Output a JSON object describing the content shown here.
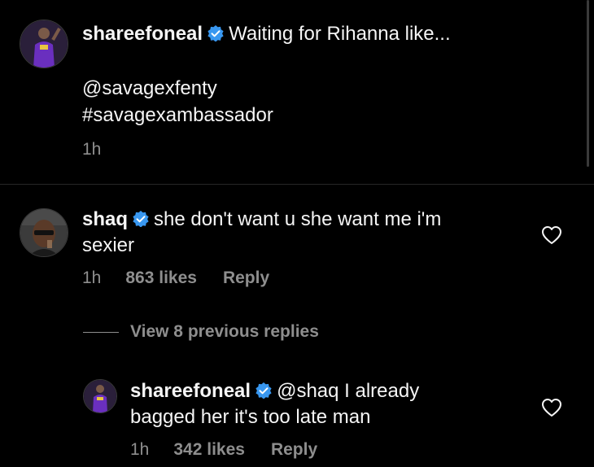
{
  "caption": {
    "username": "shareefoneal",
    "text": "Waiting for Rihanna like...",
    "mention": "@savagexfenty",
    "hashtag": "#savagexambassador",
    "time": "1h"
  },
  "comments": [
    {
      "username": "shaq",
      "text_line1": "she don't want u she want me i'm",
      "text_line2": "sexier",
      "time": "1h",
      "likes": "863 likes",
      "reply": "Reply"
    }
  ],
  "view_replies": {
    "label": "View 8 previous replies"
  },
  "replies": [
    {
      "username": "shareefoneal",
      "mention": "@shaq",
      "text_line1_rest": "I already",
      "text_line2": "bagged her it's too late man",
      "time": "1h",
      "likes": "342 likes",
      "reply": "Reply"
    }
  ],
  "colors": {
    "background": "#000000",
    "text": "#f5f5f5",
    "secondary": "#8e8e8e",
    "verified": "#3897f0"
  },
  "icons": [
    "verified-badge-icon",
    "heart-icon"
  ]
}
